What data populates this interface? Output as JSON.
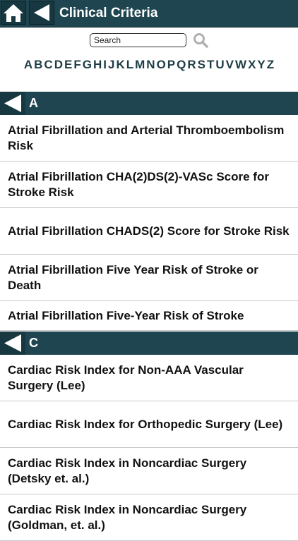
{
  "header": {
    "title": "Clinical Criteria"
  },
  "search": {
    "placeholder": "Search"
  },
  "alphabet": [
    "A",
    "B",
    "C",
    "D",
    "E",
    "F",
    "G",
    "H",
    "I",
    "J",
    "K",
    "L",
    "M",
    "N",
    "O",
    "P",
    "Q",
    "R",
    "S",
    "T",
    "U",
    "V",
    "W",
    "X",
    "Y",
    "Z"
  ],
  "sections": [
    {
      "letter": "A",
      "items": [
        "Atrial Fibrillation and Arterial Thromboembolism Risk",
        "Atrial Fibrillation CHA(2)DS(2)-VASc Score for Stroke Risk",
        "Atrial Fibrillation CHADS(2) Score for Stroke Risk",
        "Atrial Fibrillation Five Year Risk of Stroke or Death",
        "Atrial Fibrillation Five-Year Risk of Stroke"
      ]
    },
    {
      "letter": "C",
      "items": [
        "Cardiac Risk Index for Non-AAA Vascular Surgery (Lee)",
        "Cardiac Risk Index for Orthopedic Surgery (Lee)",
        "Cardiac Risk Index in Noncardiac Surgery (Detsky et. al.)",
        "Cardiac Risk Index in Noncardiac Surgery (Goldman, et. al.)"
      ]
    }
  ],
  "colors": {
    "bar": "#1f4650",
    "button": "#173840",
    "alpha_text": "#1e3c46"
  },
  "icons": [
    "home-icon",
    "back-arrow-icon",
    "search-icon"
  ]
}
